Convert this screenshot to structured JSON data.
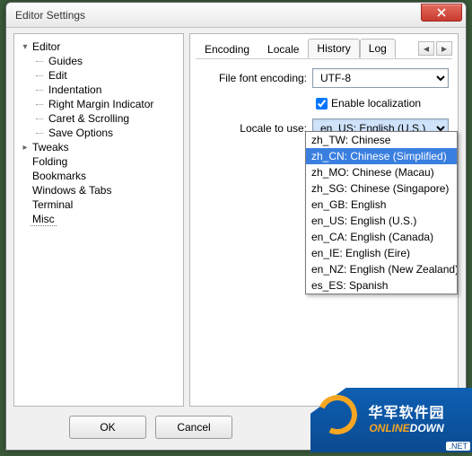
{
  "window": {
    "title": "Editor Settings"
  },
  "tree": {
    "root": {
      "label": "Editor",
      "children": [
        {
          "label": "Guides"
        },
        {
          "label": "Edit"
        },
        {
          "label": "Indentation"
        },
        {
          "label": "Right Margin Indicator"
        },
        {
          "label": "Caret & Scrolling"
        },
        {
          "label": "Save Options"
        }
      ]
    },
    "siblings": [
      {
        "label": "Tweaks",
        "expandable": true
      },
      {
        "label": "Folding"
      },
      {
        "label": "Bookmarks"
      },
      {
        "label": "Windows & Tabs"
      },
      {
        "label": "Terminal"
      },
      {
        "label": "Misc",
        "selected": true
      }
    ]
  },
  "tabs": {
    "items": [
      {
        "label": "Encoding",
        "active": true
      },
      {
        "label": "Locale"
      },
      {
        "label": "History",
        "framed": true
      },
      {
        "label": "Log",
        "framed": true
      }
    ],
    "nav_prev": "◂",
    "nav_next": "▸"
  },
  "form": {
    "encoding_label": "File font encoding:",
    "encoding_value": "UTF-8",
    "enable_localization_label": "Enable localization",
    "enable_localization_checked": true,
    "locale_label": "Locale to use:",
    "locale_value": "en_US: English (U.S.)",
    "locale_options": [
      {
        "label": "zh_TW: Chinese"
      },
      {
        "label": "zh_CN: Chinese (Simplified)",
        "hot": true
      },
      {
        "label": "zh_MO: Chinese (Macau)"
      },
      {
        "label": "zh_SG: Chinese (Singapore)"
      },
      {
        "label": "en_GB: English"
      },
      {
        "label": "en_US: English (U.S.)"
      },
      {
        "label": "en_CA: English (Canada)"
      },
      {
        "label": "en_IE: English (Eire)"
      },
      {
        "label": "en_NZ: English (New Zealand)"
      },
      {
        "label": "es_ES: Spanish"
      }
    ]
  },
  "buttons": {
    "ok": "OK",
    "cancel": "Cancel"
  },
  "watermark": {
    "cn": "华军软件园",
    "en_a": "ONLINE",
    "en_b": "DOWN",
    "net": ".NET"
  }
}
